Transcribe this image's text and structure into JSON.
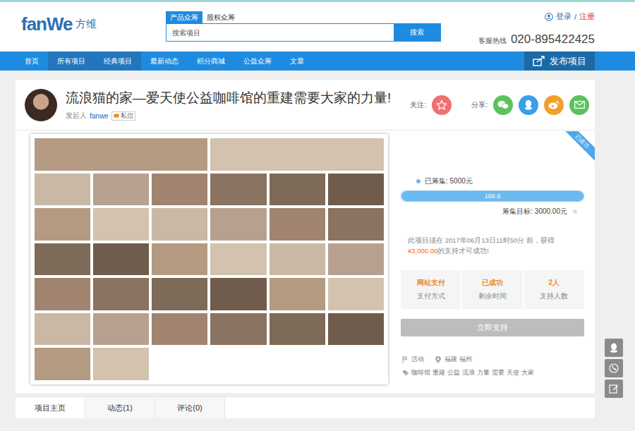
{
  "logo": {
    "brand": "fanWe",
    "name": "方维"
  },
  "search": {
    "tabs": [
      {
        "label": "产品众筹",
        "selected": true
      },
      {
        "label": "股权众筹",
        "selected": false
      }
    ],
    "placeholder": "搜索项目",
    "button": "搜索"
  },
  "account": {
    "login": "登录",
    "separator": "/",
    "register": "注册"
  },
  "hotline": {
    "label": "客服热线",
    "number": "020-895422425"
  },
  "nav": {
    "items": [
      {
        "label": "首页",
        "selected": false
      },
      {
        "label": "所有项目",
        "selected": true
      },
      {
        "label": "经典项目",
        "selected": true
      },
      {
        "label": "最新动态",
        "selected": false
      },
      {
        "label": "积分商城",
        "selected": false
      },
      {
        "label": "公益众筹",
        "selected": false
      },
      {
        "label": "文章",
        "selected": false
      }
    ],
    "publish": "发布项目"
  },
  "project": {
    "title": "流浪猫的家—爱天使公益咖啡馆的重建需要大家的力量!",
    "initiator_label": "发起人",
    "initiator": "fanwe",
    "message": "私信",
    "follow_label": "关注:",
    "share_label": "分享:",
    "badge": "已成功",
    "raised": "已筹集: 5000元",
    "progress": {
      "level": 1,
      "reading": "166.6"
    },
    "goal": "筹集目标: 3000.00元",
    "notice": {
      "before": "此项目须在 2017年06月13日11时50分 前，获得",
      "amount": "¥3,000.00",
      "after": "的支持才可成功!"
    },
    "stats": [
      {
        "value": "网站支付",
        "label": "支付方式"
      },
      {
        "value": "已成功",
        "label": "剩余时间"
      },
      {
        "value": "2人",
        "label": "支持人数"
      }
    ],
    "support_button": "立即支持",
    "category": "活动",
    "location": "福建 福州",
    "tags": [
      "咖啡馆",
      "重建",
      "公益",
      "流浪",
      "力量",
      "需要",
      "天使",
      "大家"
    ]
  },
  "tabs": [
    {
      "label": "项目主页",
      "selected": true
    },
    {
      "label": "动态(1)",
      "selected": false
    },
    {
      "label": "评论(0)",
      "selected": false
    }
  ]
}
